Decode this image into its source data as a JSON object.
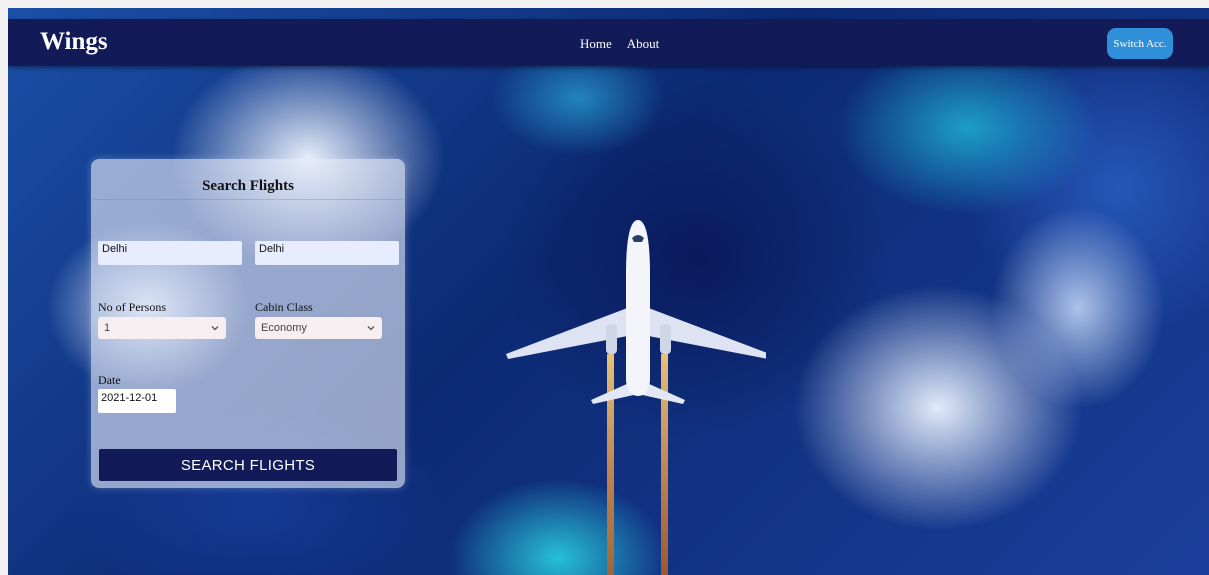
{
  "app": {
    "brand": "Wings"
  },
  "nav": {
    "links": [
      "Home",
      "About"
    ],
    "switch_account_label": "Switch Acc."
  },
  "search_panel": {
    "title": "Search Flights",
    "from_value": "Delhi",
    "to_value": "Delhi",
    "persons_label": "No of Persons",
    "persons_value": "1",
    "cabin_label": "Cabin Class",
    "cabin_value": "Economy",
    "date_label": "Date",
    "date_value": "2021-12-01",
    "submit_label": "SEARCH FLIGHTS"
  },
  "icons": {
    "select_arrow": "chevron-down-icon",
    "airplane": "airplane-illustration"
  },
  "colors": {
    "navbar": "#121b57",
    "accent": "#2f8fd8",
    "button": "#121b57"
  }
}
